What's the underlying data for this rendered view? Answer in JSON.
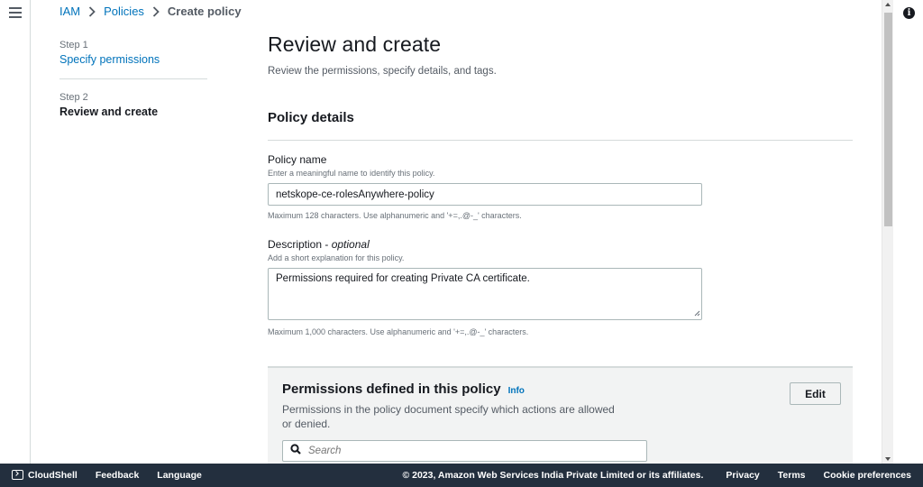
{
  "breadcrumb": {
    "items": [
      "IAM",
      "Policies"
    ],
    "current": "Create policy"
  },
  "steps": [
    {
      "number": "Step 1",
      "label": "Specify permissions"
    },
    {
      "number": "Step 2",
      "label": "Review and create"
    }
  ],
  "page": {
    "title": "Review and create",
    "subtitle": "Review the permissions, specify details, and tags."
  },
  "policy_details": {
    "title": "Policy details",
    "name": {
      "label": "Policy name",
      "description": "Enter a meaningful name to identify this policy.",
      "value": "netskope-ce-rolesAnywhere-policy",
      "constraint": "Maximum 128 characters. Use alphanumeric and '+=,.@-_' characters."
    },
    "description": {
      "label": "Description",
      "optional": "optional",
      "separator": " - ",
      "description": "Add a short explanation for this policy.",
      "value": "Permissions required for creating Private CA certificate.",
      "constraint": "Maximum 1,000 characters. Use alphanumeric and '+=,.@-_' characters."
    }
  },
  "permissions": {
    "title": "Permissions defined in this policy",
    "info_label": "Info",
    "description": "Permissions in the policy document specify which actions are allowed or denied.",
    "edit_label": "Edit",
    "search_placeholder": "Search"
  },
  "footer": {
    "cloudshell": "CloudShell",
    "feedback": "Feedback",
    "language": "Language",
    "copyright": "© 2023, Amazon Web Services India Private Limited or its affiliates.",
    "privacy": "Privacy",
    "terms": "Terms",
    "cookie": "Cookie preferences"
  },
  "colors": {
    "link": "#0073bb",
    "footer_bg": "#232f3e",
    "panel_bg": "#f2f3f3"
  },
  "icons": {
    "menu": "hamburger-menu-icon",
    "info": "info-circle-icon",
    "search": "search-icon",
    "cloudshell": "terminal-icon"
  }
}
